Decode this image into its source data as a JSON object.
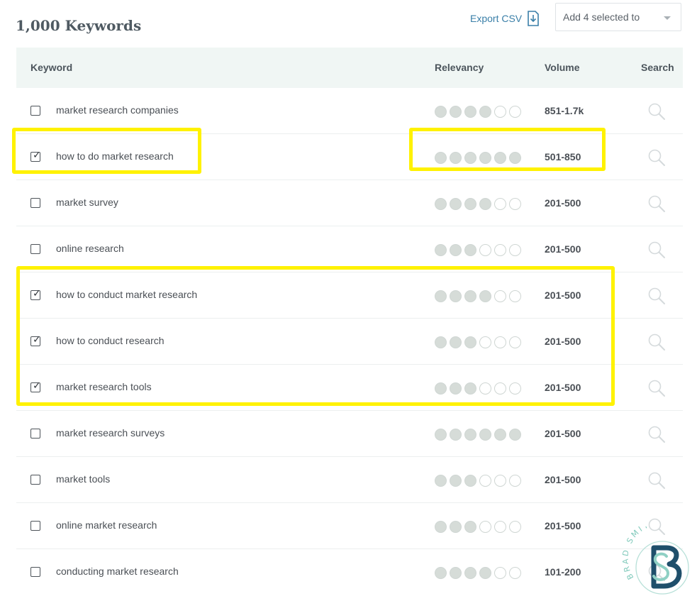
{
  "header": {
    "title": "1,000 Keywords",
    "export_label": "Export CSV",
    "add_selected_label": "Add 4 selected to"
  },
  "table": {
    "columns": [
      "Keyword",
      "Relevancy",
      "Volume",
      "Search"
    ],
    "rows": [
      {
        "keyword": "market research companies",
        "checked": false,
        "relevancy": 4,
        "volume": "851-1.7k"
      },
      {
        "keyword": "how to do market research",
        "checked": true,
        "relevancy": 6,
        "volume": "501-850"
      },
      {
        "keyword": "market survey",
        "checked": false,
        "relevancy": 4,
        "volume": "201-500"
      },
      {
        "keyword": "online research",
        "checked": false,
        "relevancy": 3,
        "volume": "201-500"
      },
      {
        "keyword": "how to conduct market research",
        "checked": true,
        "relevancy": 4,
        "volume": "201-500"
      },
      {
        "keyword": "how to conduct research",
        "checked": true,
        "relevancy": 3,
        "volume": "201-500"
      },
      {
        "keyword": "market research tools",
        "checked": true,
        "relevancy": 3,
        "volume": "201-500"
      },
      {
        "keyword": "market research surveys",
        "checked": false,
        "relevancy": 6,
        "volume": "201-500"
      },
      {
        "keyword": "market tools",
        "checked": false,
        "relevancy": 3,
        "volume": "201-500"
      },
      {
        "keyword": "online market research",
        "checked": false,
        "relevancy": 3,
        "volume": "201-500"
      },
      {
        "keyword": "conducting market research",
        "checked": false,
        "relevancy": 4,
        "volume": "101-200"
      }
    ]
  },
  "watermark": {
    "text": "BRAD SMITH",
    "monogram": "SB"
  },
  "colors": {
    "accent": "#3a7fa8",
    "highlight": "#fff200",
    "header_bg": "#f0f6f4",
    "dot_fill": "#d6dcd8",
    "logo_dark": "#1f4f6b",
    "logo_light": "#8fd0c4"
  }
}
